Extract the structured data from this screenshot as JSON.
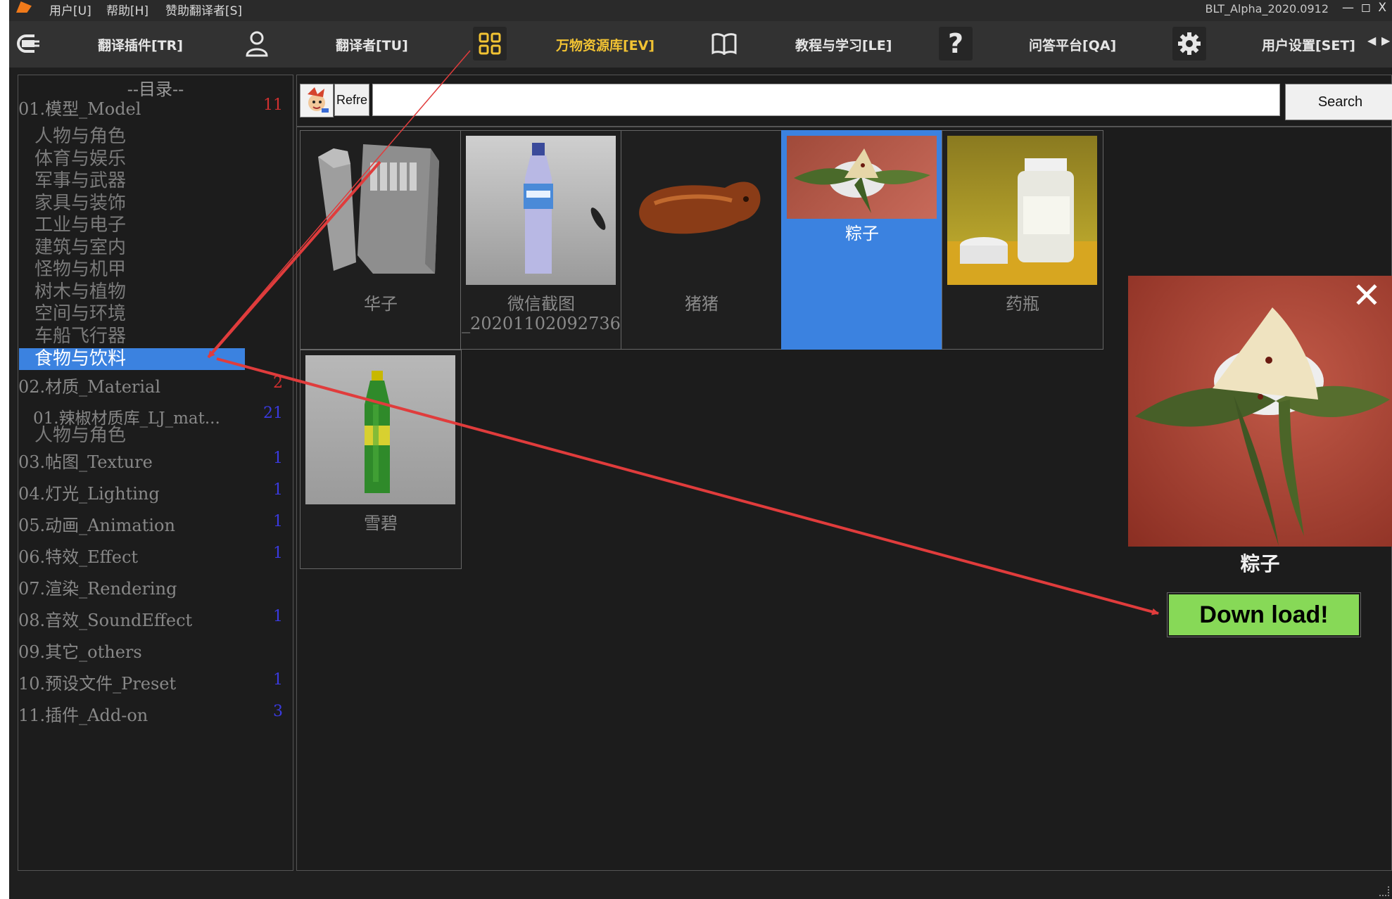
{
  "menubar": {
    "items": [
      "用户[U]",
      "帮助[H]",
      "赞助翻译者[S]"
    ],
    "version": "BLT_Alpha_2020.0912",
    "window_controls": [
      "—",
      "◻",
      "X"
    ]
  },
  "toolbar": {
    "tabs": [
      {
        "label": "翻译插件[TR]",
        "icon": "plug-icon"
      },
      {
        "label": "翻译者[TU]",
        "icon": "user-icon"
      },
      {
        "label": "万物资源库[EV]",
        "icon": "grid-icon",
        "active": true
      },
      {
        "label": "教程与学习[LE]",
        "icon": "book-icon"
      },
      {
        "label": "问答平台[QA]",
        "icon": "question-icon"
      },
      {
        "label": "用户设置[SET]",
        "icon": "gear-icon"
      }
    ],
    "question_glyph": "?",
    "accent_color": "#f2c333"
  },
  "sidebar": {
    "title": "--目录--",
    "categories": [
      {
        "label": "01.模型_Model",
        "count": "11",
        "count_color": "red"
      },
      {
        "label": "02.材质_Material",
        "count": "2",
        "count_color": "red"
      },
      {
        "label": "03.帖图_Texture",
        "count": "1",
        "count_color": "blue"
      },
      {
        "label": "04.灯光_Lighting",
        "count": "1",
        "count_color": "blue"
      },
      {
        "label": "05.动画_Animation",
        "count": "1",
        "count_color": "blue"
      },
      {
        "label": "06.特效_Effect",
        "count": "1",
        "count_color": "blue"
      },
      {
        "label": "07.渲染_Rendering",
        "count": "",
        "count_color": "blue"
      },
      {
        "label": "08.音效_SoundEffect",
        "count": "1",
        "count_color": "blue"
      },
      {
        "label": "09.其它_others",
        "count": "",
        "count_color": "blue"
      },
      {
        "label": "10.预设文件_Preset",
        "count": "1",
        "count_color": "blue"
      },
      {
        "label": "11.插件_Add-on",
        "count": "3",
        "count_color": "blue"
      }
    ],
    "model_subitems": [
      "人物与角色",
      "体育与娱乐",
      "军事与武器",
      "家具与装饰",
      "工业与电子",
      "建筑与室内",
      "怪物与机甲",
      "树木与植物",
      "空间与环境",
      "车船飞行器",
      "食物与饮料"
    ],
    "selected_subitem": "食物与饮料",
    "material_subitems": [
      {
        "label": "01.辣椒材质库_LJ_mat...",
        "count": "21"
      },
      {
        "label": "人物与角色",
        "count": ""
      }
    ]
  },
  "search": {
    "refresh_label": "Refre",
    "placeholder": "",
    "value": "",
    "button_label": "Search"
  },
  "assets": [
    {
      "name": "华子",
      "image": "lighter-and-cigarette-pack",
      "selected": false
    },
    {
      "name": "微信截图\n_20201102092736",
      "image": "water-bottle",
      "selected": false
    },
    {
      "name": "猪猪",
      "image": "roast-pig",
      "selected": false
    },
    {
      "name": "粽子",
      "image": "zongzi",
      "selected": true
    },
    {
      "name": "药瓶",
      "image": "medicine-bottle",
      "selected": false
    },
    {
      "name": "雪碧",
      "image": "sprite-bottle",
      "selected": false
    }
  ],
  "preview": {
    "name": "粽子",
    "download_label": "Down load!",
    "close_glyph": "✕",
    "download_color": "#87d957"
  },
  "annotation": {
    "arrow_color": "#e03c3c"
  }
}
